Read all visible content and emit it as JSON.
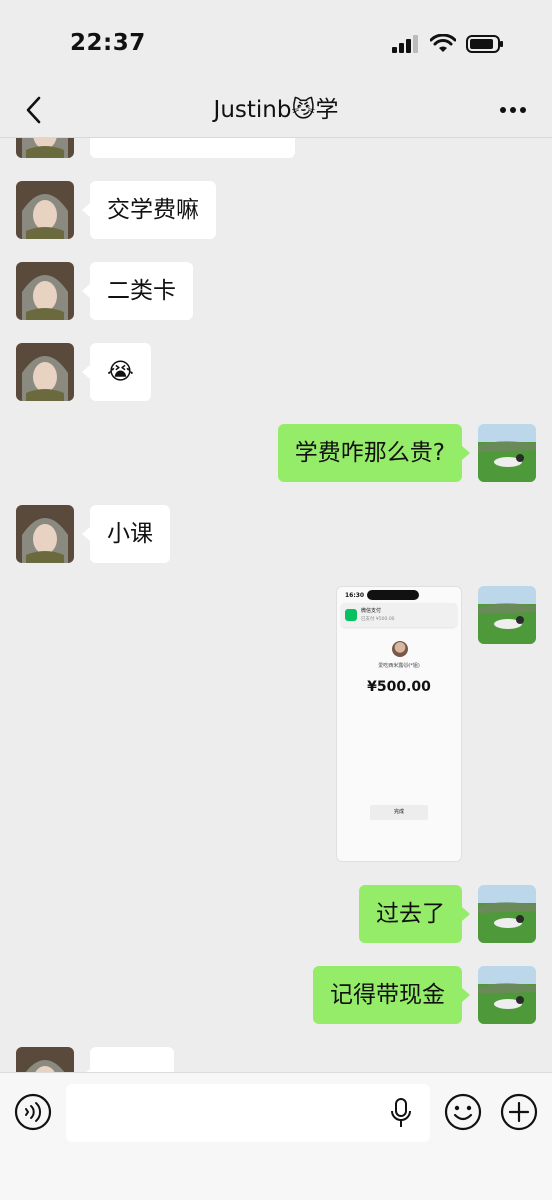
{
  "status": {
    "time": "22:37"
  },
  "nav": {
    "title": "Justinb😼学"
  },
  "messages": {
    "m1": "交学费嘛",
    "m2": "二类卡",
    "m3": "😭",
    "m4": "学费咋那么贵?",
    "m5": "小课",
    "m7": "过去了",
    "m8": "记得带现金"
  },
  "payment_screenshot": {
    "status_time": "16:30",
    "notice_title": "微信支付",
    "notice_body": "已支付 ¥500.00",
    "payee": "爱吃西米露🐱(*姐)",
    "amount": "¥500.00",
    "done_label": "完成"
  },
  "input": {
    "placeholder": ""
  },
  "colors": {
    "background": "#ededed",
    "self_bubble": "#95ec69",
    "other_bubble": "#ffffff",
    "wechat_green": "#07c160"
  },
  "icons": {
    "back": "chevron-left-icon",
    "more": "ellipsis-icon",
    "voice": "voice-icon",
    "mic": "microphone-icon",
    "emoji": "emoji-icon",
    "plus": "plus-icon"
  }
}
